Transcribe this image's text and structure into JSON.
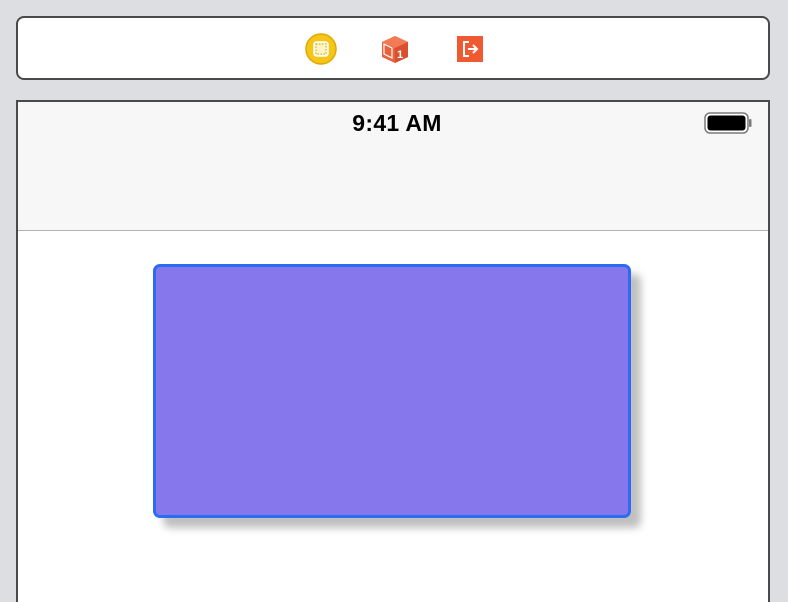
{
  "scene_dock": {
    "icons": [
      {
        "name": "view-controller-icon",
        "color": "#f5c518"
      },
      {
        "name": "first-responder-icon",
        "color": "#e8603c"
      },
      {
        "name": "exit-icon",
        "color": "#f05a32"
      }
    ]
  },
  "status_bar": {
    "time": "9:41 AM",
    "battery": "battery-icon"
  },
  "canvas": {
    "view_fill": "#8678ec",
    "view_selection_border": "#2c6cf0",
    "nav_bar_color": "#f7f7f7"
  }
}
